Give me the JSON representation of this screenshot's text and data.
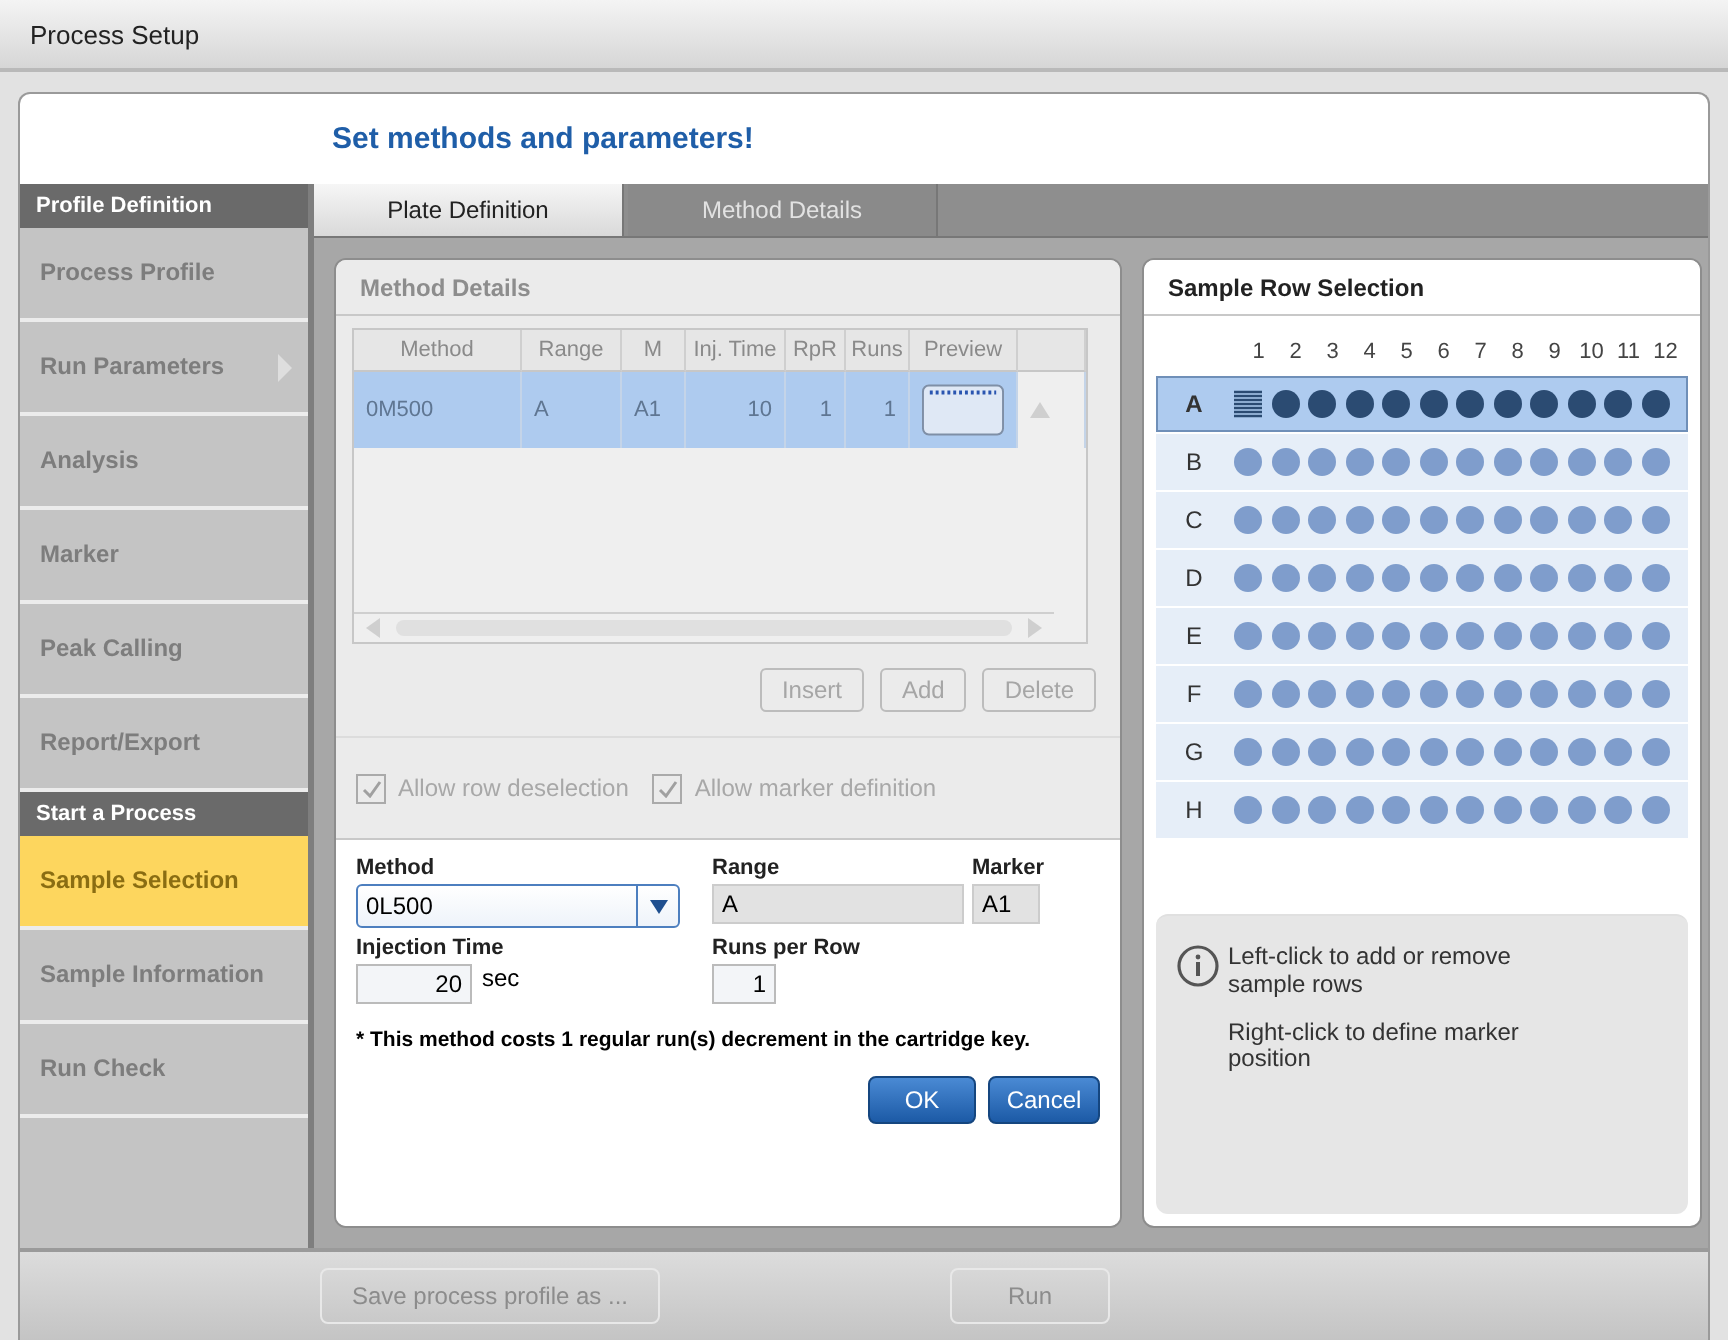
{
  "window": {
    "title": "Process Setup"
  },
  "heading": "Set methods and parameters!",
  "sidebar": {
    "sections": [
      {
        "title": "Profile Definition",
        "items": [
          {
            "label": "Process Profile",
            "selected": false,
            "has_submenu": false
          },
          {
            "label": "Run Parameters",
            "selected": false,
            "has_submenu": true
          },
          {
            "label": "Analysis",
            "selected": false,
            "has_submenu": false
          },
          {
            "label": "Marker",
            "selected": false,
            "has_submenu": false
          },
          {
            "label": "Peak Calling",
            "selected": false,
            "has_submenu": false
          },
          {
            "label": "Report/Export",
            "selected": false,
            "has_submenu": false
          }
        ]
      },
      {
        "title": "Start a Process",
        "items": [
          {
            "label": "Sample Selection",
            "selected": true,
            "has_submenu": false
          },
          {
            "label": "Sample Information",
            "selected": false,
            "has_submenu": false
          },
          {
            "label": "Run Check",
            "selected": false,
            "has_submenu": false
          }
        ]
      }
    ]
  },
  "tabs": [
    {
      "label": "Plate Definition",
      "selected": true,
      "disabled": false
    },
    {
      "label": "Method Details",
      "selected": false,
      "disabled": true
    }
  ],
  "method_panel": {
    "title": "Method Details",
    "table": {
      "columns": [
        "Method",
        "Range",
        "M",
        "Inj. Time",
        "RpR",
        "Runs",
        "Preview"
      ],
      "rows": [
        {
          "cells": [
            "0M500",
            "A",
            "A1",
            "10",
            "1",
            "1"
          ],
          "selected": true
        }
      ]
    },
    "buttons": [
      {
        "label": "Insert",
        "disabled": true
      },
      {
        "label": "Add",
        "disabled": true
      },
      {
        "label": "Delete",
        "disabled": true
      }
    ],
    "checkboxes": [
      {
        "label": "Allow row deselection",
        "checked": true,
        "disabled": true
      },
      {
        "label": "Allow marker definition",
        "checked": true,
        "disabled": true
      }
    ],
    "form": {
      "method": {
        "label": "Method",
        "value": "0L500"
      },
      "range": {
        "label": "Range",
        "value": "A"
      },
      "marker": {
        "label": "Marker",
        "value": "A1"
      },
      "injection_time": {
        "label": "Injection Time",
        "value": "20",
        "unit": "sec"
      },
      "runs_per_row": {
        "label": "Runs per Row",
        "value": "1"
      },
      "note": "* This method costs 1 regular run(s) decrement in the cartridge key.",
      "buttons": [
        "OK",
        "Cancel"
      ]
    }
  },
  "sample_panel": {
    "title": "Sample Row Selection",
    "columns": [
      "1",
      "2",
      "3",
      "4",
      "5",
      "6",
      "7",
      "8",
      "9",
      "10",
      "11",
      "12"
    ],
    "rows": [
      {
        "label": "A",
        "selected": true,
        "marker": true
      },
      {
        "label": "B",
        "selected": false,
        "marker": false
      },
      {
        "label": "C",
        "selected": false,
        "marker": false
      },
      {
        "label": "D",
        "selected": false,
        "marker": false
      },
      {
        "label": "E",
        "selected": false,
        "marker": false
      },
      {
        "label": "F",
        "selected": false,
        "marker": false
      },
      {
        "label": "G",
        "selected": false,
        "marker": false
      },
      {
        "label": "H",
        "selected": false,
        "marker": false
      }
    ],
    "info": [
      "Left-click to add or remove sample rows",
      "Right-click to define marker position"
    ]
  },
  "footer_buttons": [
    {
      "label": "Save process profile as ...",
      "disabled": true
    },
    {
      "label": "Run",
      "disabled": true
    }
  ]
}
